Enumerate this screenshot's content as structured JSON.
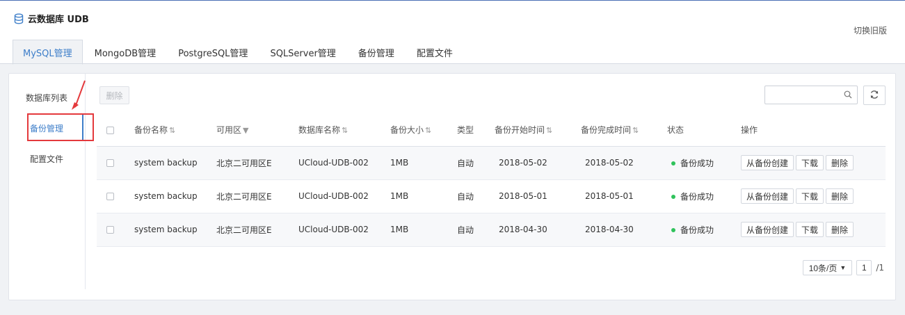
{
  "app": {
    "title": "云数据库 UDB",
    "switch_label": "切换旧版"
  },
  "tabs": [
    {
      "label": "MySQL管理"
    },
    {
      "label": "MongoDB管理"
    },
    {
      "label": "PostgreSQL管理"
    },
    {
      "label": "SQLServer管理"
    },
    {
      "label": "备份管理"
    },
    {
      "label": "配置文件"
    }
  ],
  "sidebar": {
    "items": [
      {
        "label": "数据库列表"
      },
      {
        "label": "备份管理"
      },
      {
        "label": "配置文件"
      }
    ]
  },
  "toolbar": {
    "delete_label": "删除",
    "search_placeholder": ""
  },
  "table": {
    "headers": {
      "name": "备份名称",
      "zone": "可用区",
      "db": "数据库名称",
      "size": "备份大小",
      "type": "类型",
      "start": "备份开始时间",
      "end": "备份完成时间",
      "status": "状态",
      "ops": "操作"
    },
    "rows": [
      {
        "name": "system backup",
        "zone": "北京二可用区E",
        "db": "UCloud-UDB-002",
        "size": "1MB",
        "type": "自动",
        "start": "2018-05-02",
        "end": "2018-05-02",
        "status": "备份成功"
      },
      {
        "name": "system backup",
        "zone": "北京二可用区E",
        "db": "UCloud-UDB-002",
        "size": "1MB",
        "type": "自动",
        "start": "2018-05-01",
        "end": "2018-05-01",
        "status": "备份成功"
      },
      {
        "name": "system backup",
        "zone": "北京二可用区E",
        "db": "UCloud-UDB-002",
        "size": "1MB",
        "type": "自动",
        "start": "2018-04-30",
        "end": "2018-04-30",
        "status": "备份成功"
      }
    ],
    "ops": {
      "create": "从备份创建",
      "download": "下载",
      "delete": "删除"
    }
  },
  "pager": {
    "page_size": "10条/页",
    "current_page": "1",
    "total": "/1"
  },
  "colors": {
    "accent": "#3d7ec9",
    "success": "#2fc25b",
    "highlight": "#e4393c"
  }
}
